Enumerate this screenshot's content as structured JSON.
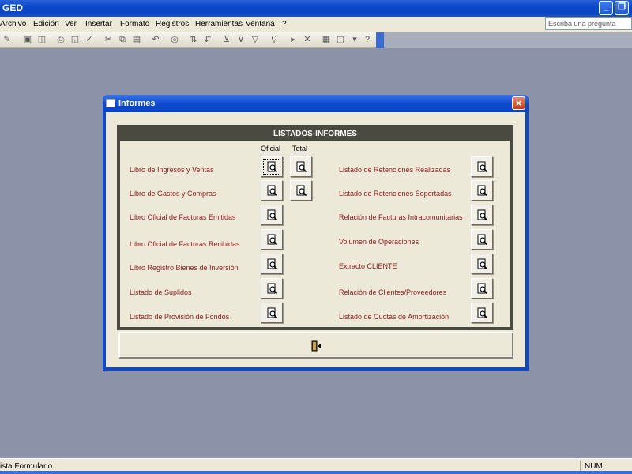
{
  "window": {
    "title": "GED"
  },
  "menu": [
    "Archivo",
    "Edición",
    "Ver",
    "Insertar",
    "Formato",
    "Registros",
    "Herramientas",
    "Ventana",
    "?"
  ],
  "help": {
    "placeholder": "Escriba una pregunta"
  },
  "dialog": {
    "title": "Informes",
    "panel_title": "LISTADOS-INFORMES",
    "col_oficial": "Oficial",
    "col_total": "Total",
    "left": [
      "Libro de Ingresos y Ventas",
      "Libro de Gastos y Compras",
      "Libro Oficial de Facturas Emitidas",
      "Libro Oficial de Facturas Recibidas",
      "Libro Registro Bienes de Inversión",
      "Listado de Suplidos",
      "Listado de Provisión de Fondos"
    ],
    "right": [
      "Listado de Retenciones Realizadas",
      "Listado de Retenciones Soportadas",
      "Relación de Facturas Intracomunitarias",
      "Volumen de Operaciones",
      "Extracto CLIENTE",
      "Relación de Clientes/Proveedores",
      "Listado de Cuotas de Amortización"
    ]
  },
  "status": {
    "left": "ista Formulario",
    "right": "NUM"
  }
}
